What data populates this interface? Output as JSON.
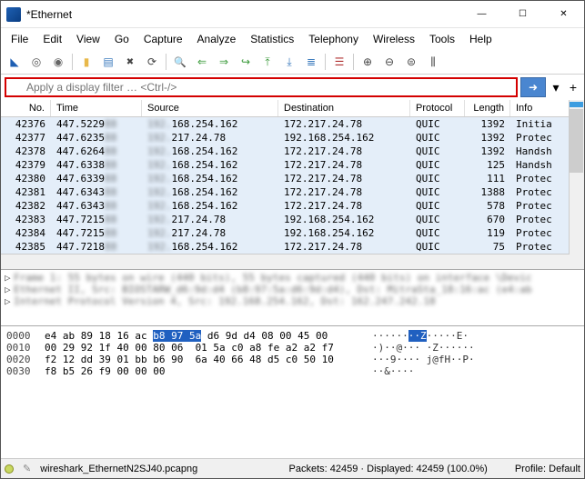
{
  "window": {
    "title": "*Ethernet",
    "controls": {
      "min": "—",
      "max": "☐",
      "close": "✕"
    }
  },
  "menu": [
    "File",
    "Edit",
    "View",
    "Go",
    "Capture",
    "Analyze",
    "Statistics",
    "Telephony",
    "Wireless",
    "Tools",
    "Help"
  ],
  "filter": {
    "placeholder": "Apply a display filter … <Ctrl-/>",
    "arrow": "➜",
    "drop": "▾",
    "plus": "+"
  },
  "columns": {
    "no": "No.",
    "time": "Time",
    "src": "Source",
    "dst": "Destination",
    "proto": "Protocol",
    "len": "Length",
    "info": "Info"
  },
  "packets": [
    {
      "no": "42376",
      "time": "447.5229",
      "src": "168.254.162",
      "dst": "172.217.24.78",
      "proto": "QUIC",
      "len": "1392",
      "info": "Initia"
    },
    {
      "no": "42377",
      "time": "447.6235",
      "src": "217.24.78",
      "dst": "192.168.254.162",
      "proto": "QUIC",
      "len": "1392",
      "info": "Protec"
    },
    {
      "no": "42378",
      "time": "447.6264",
      "src": "168.254.162",
      "dst": "172.217.24.78",
      "proto": "QUIC",
      "len": "1392",
      "info": "Handsh"
    },
    {
      "no": "42379",
      "time": "447.6338",
      "src": "168.254.162",
      "dst": "172.217.24.78",
      "proto": "QUIC",
      "len": "125",
      "info": "Handsh"
    },
    {
      "no": "42380",
      "time": "447.6339",
      "src": "168.254.162",
      "dst": "172.217.24.78",
      "proto": "QUIC",
      "len": "111",
      "info": "Protec"
    },
    {
      "no": "42381",
      "time": "447.6343",
      "src": "168.254.162",
      "dst": "172.217.24.78",
      "proto": "QUIC",
      "len": "1388",
      "info": "Protec"
    },
    {
      "no": "42382",
      "time": "447.6343",
      "src": "168.254.162",
      "dst": "172.217.24.78",
      "proto": "QUIC",
      "len": "578",
      "info": "Protec"
    },
    {
      "no": "42383",
      "time": "447.7215",
      "src": "217.24.78",
      "dst": "192.168.254.162",
      "proto": "QUIC",
      "len": "670",
      "info": "Protec"
    },
    {
      "no": "42384",
      "time": "447.7215",
      "src": "217.24.78",
      "dst": "192.168.254.162",
      "proto": "QUIC",
      "len": "119",
      "info": "Protec"
    },
    {
      "no": "42385",
      "time": "447.7218",
      "src": "168.254.162",
      "dst": "172.217.24.78",
      "proto": "QUIC",
      "len": "75",
      "info": "Protec"
    }
  ],
  "details": {
    "l1": "Frame 1: 55 bytes on wire (440 bits), 55 bytes captured (440 bits) on interface \\Devic",
    "l2": "Ethernet II, Src: BIOSTARW_d6:9d:d4 (b8:97:5a:d6:9d:d4), Dst: MitraSta_18:16:ac (e4:ab",
    "l3": "Internet Protocol Version 4, Src: 192.168.254.162, Dst: 162.247.242.18"
  },
  "hex": [
    {
      "off": "0000",
      "b": "e4 ab 89 18 16 ac ",
      "bsel": "b8 97 5a",
      "b2": " d6 9d d4 08 00 45 00",
      "a": "······",
      "asel": "··Z",
      "a2": "·····E·"
    },
    {
      "off": "0010",
      "b": "00 29 92 1f 40 00 80 06  01 5a c0 a8 fe a2 a2 f7",
      "a": "·)··@··· ·Z······"
    },
    {
      "off": "0020",
      "b": "f2 12 dd 39 01 bb b6 90  6a 40 66 48 d5 c0 50 10",
      "a": "···9···· j@fH··P·"
    },
    {
      "off": "0030",
      "b": "f8 b5 26 f9 00 00 00",
      "a": "··&····"
    }
  ],
  "status": {
    "file": "wireshark_EthernetN2SJ40.pcapng",
    "counts": "Packets: 42459 · Displayed: 42459 (100.0%)",
    "profile": "Profile: Default"
  }
}
